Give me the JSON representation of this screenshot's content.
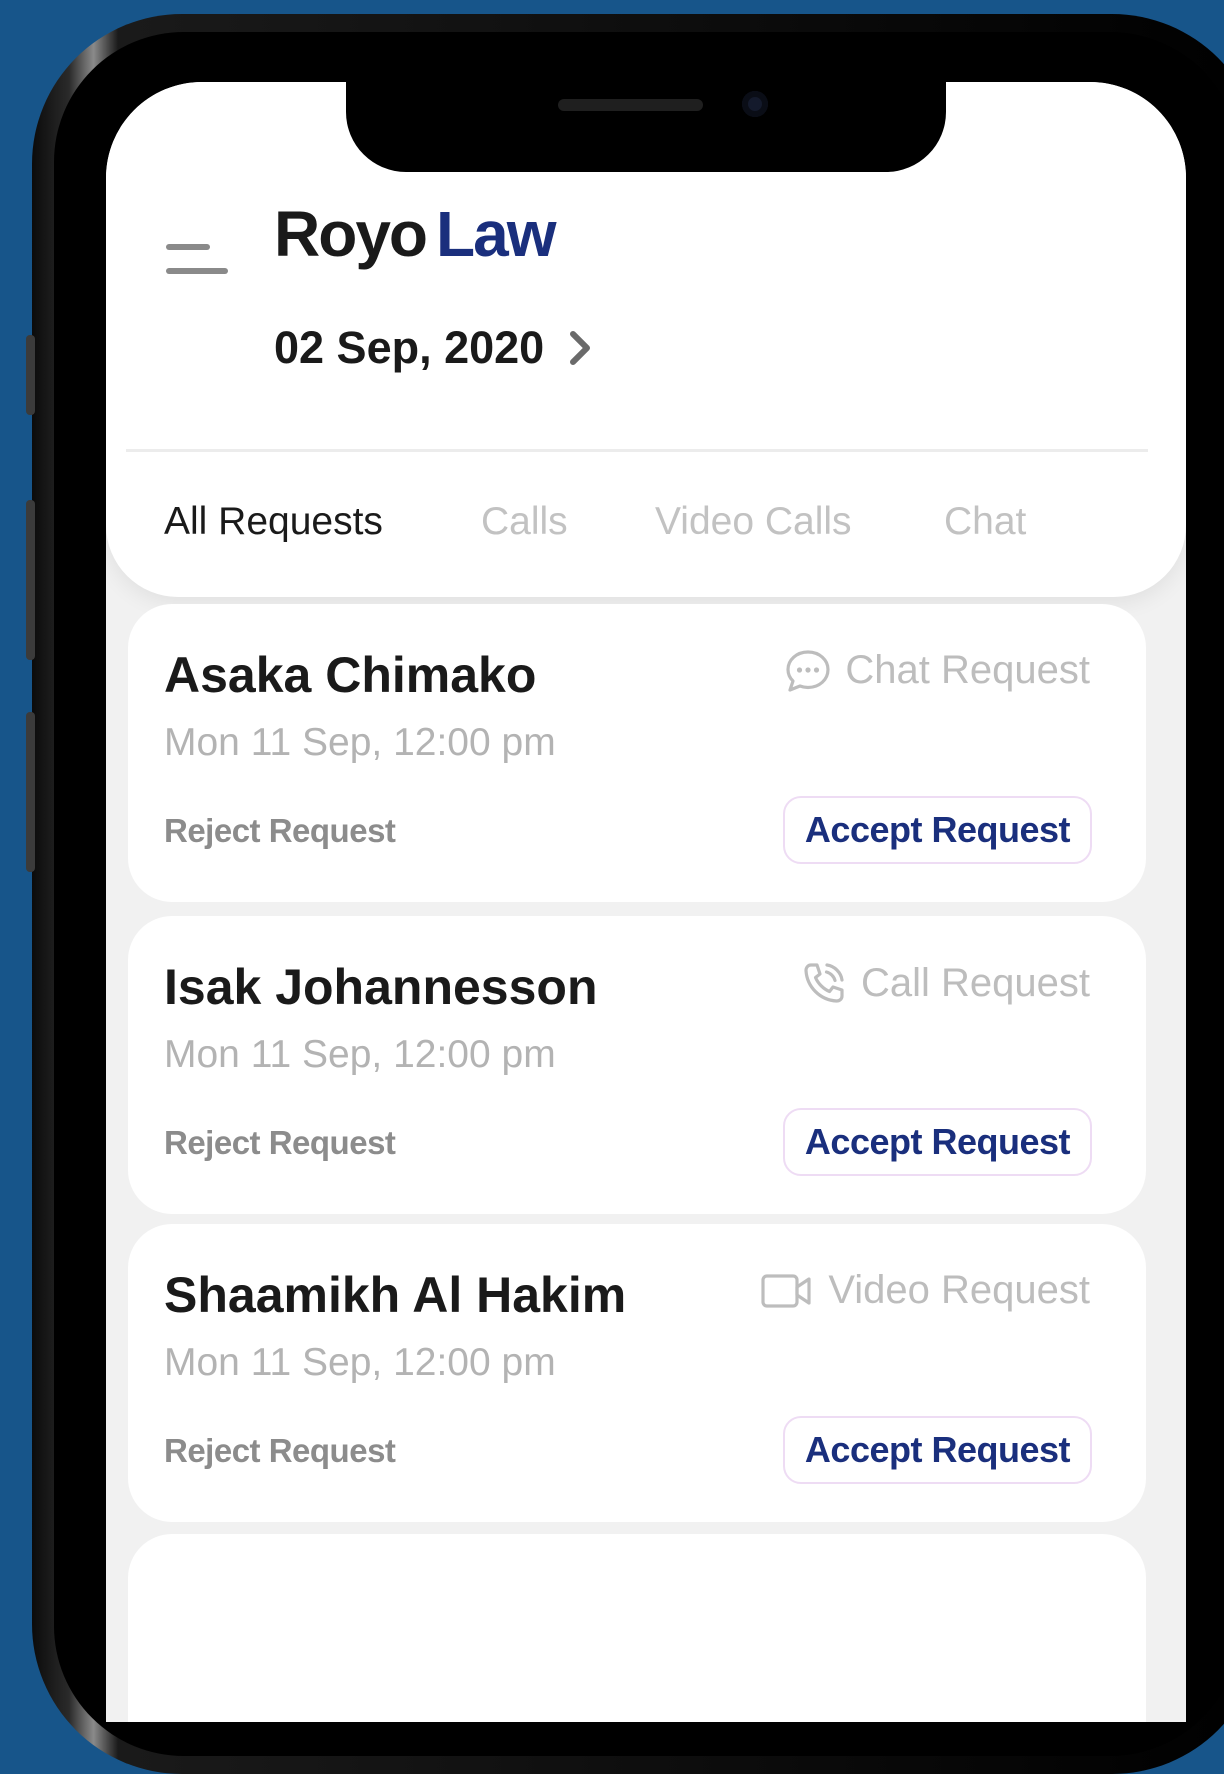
{
  "app": {
    "brand_first": "Royo",
    "brand_second": "Law",
    "accent": "#1a2f7d",
    "background": "#17558a"
  },
  "header": {
    "date": "02 Sep, 2020"
  },
  "tabs": [
    {
      "label": "All Requests",
      "active": true
    },
    {
      "label": "Calls",
      "active": false
    },
    {
      "label": "Video Calls",
      "active": false
    },
    {
      "label": "Chat",
      "active": false
    }
  ],
  "requests": [
    {
      "name": "Asaka Chimako",
      "datetime": "Mon 11 Sep, 12:00 pm",
      "type": "Chat Request",
      "icon": "chat-bubble-icon",
      "reject": "Reject Request",
      "accept": "Accept Request"
    },
    {
      "name": "Isak Johannesson",
      "datetime": "Mon 11 Sep, 12:00 pm",
      "type": "Call Request",
      "icon": "phone-call-icon",
      "reject": "Reject Request",
      "accept": "Accept Request"
    },
    {
      "name": "Shaamikh Al Hakim",
      "datetime": "Mon 11 Sep, 12:00 pm",
      "type": "Video Request",
      "icon": "video-camera-icon",
      "reject": "Reject Request",
      "accept": "Accept Request"
    }
  ]
}
